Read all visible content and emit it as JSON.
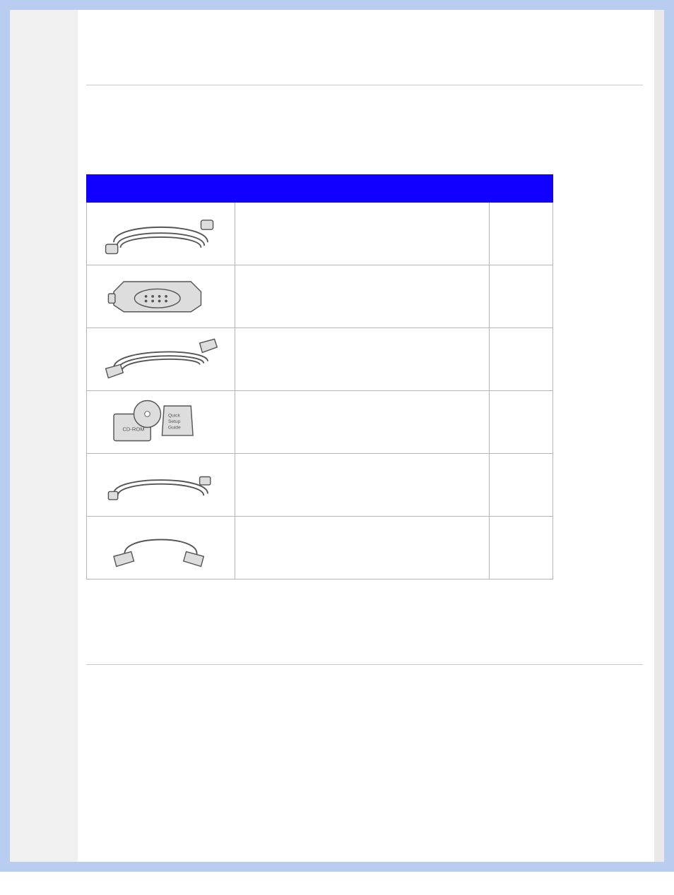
{
  "section": {
    "top_spacer": "",
    "hr1": "",
    "hr2": ""
  },
  "table": {
    "headers": {
      "image": "",
      "description": "",
      "quantity": ""
    },
    "rows": [
      {
        "description": "",
        "quantity": ""
      },
      {
        "description": "",
        "quantity": ""
      },
      {
        "description": "",
        "quantity": ""
      },
      {
        "description": "",
        "quantity": ""
      },
      {
        "description": "",
        "quantity": ""
      },
      {
        "description": "",
        "quantity": ""
      }
    ]
  }
}
